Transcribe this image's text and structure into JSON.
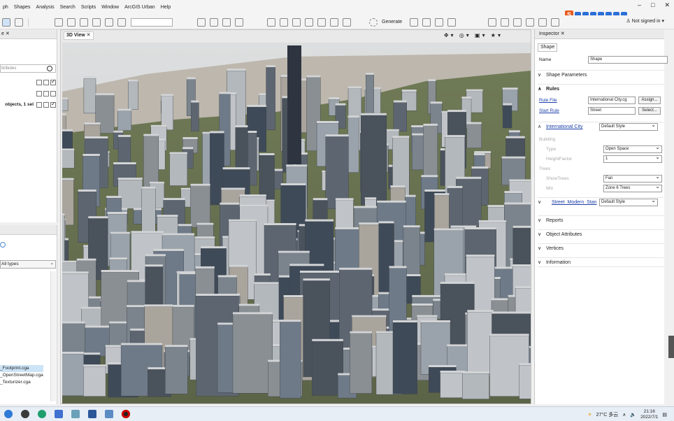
{
  "menubar": {
    "items": [
      "ph",
      "Shapes",
      "Analysis",
      "Search",
      "Scripts",
      "Window",
      "ArcGIS Urban",
      "Help"
    ],
    "window_controls": [
      "–",
      "□",
      "✕"
    ]
  },
  "toolbar": {
    "generate_label": "Generate",
    "signed_in_label": "Not signed in",
    "signed_in_arrow": "▾"
  },
  "left_top": {
    "tab_label": "e ✕",
    "search_placeholder": "ttributes",
    "objects_label": "objects, 1 sel"
  },
  "left_bottom": {
    "type_select": "All types",
    "files": [
      "_Footprint.cga",
      "_OpenStreetMap.cga",
      "_Texturizer.cga"
    ]
  },
  "view": {
    "tab_label": "3D View ✕"
  },
  "inspector": {
    "tab_label": "Inspector ✕",
    "shape_tab": "Shape",
    "name_label": "Name",
    "name_value": "Shape",
    "shape_parameters": "Shape Parameters",
    "rules": "Rules",
    "rule_file_label": "Rule File",
    "rule_file_value": "International City.cg",
    "assign_button": "Assign...",
    "start_rule_label": "Start Rule",
    "start_rule_value": "Street",
    "select_button": "Select...",
    "international_city_label": "International City",
    "international_city_value": "Default Style",
    "building_group": "Building",
    "type_label": "Type",
    "type_value": "Open Space",
    "height_factor_label": "HeightFactor",
    "height_factor_value": "1",
    "trees_group": "Trees",
    "show_trees_label": "ShowTrees",
    "show_trees_value": "Fan",
    "mix_label": "Mix",
    "mix_value": "Zone 6 Trees",
    "street_label": "Street_Modern_Stan",
    "street_value": "Default Style",
    "reports": "Reports",
    "object_attributes": "Object Attributes",
    "vertices": "Vertices",
    "information": "Information"
  },
  "taskbar": {
    "weather": "27°C 多云",
    "time": "21:16",
    "date": "2022/7/1"
  },
  "colors": {
    "sky": "#d7d9dc",
    "water": "#bdb7ad",
    "ground": "#6d7a52",
    "accent": "#1a3ea8"
  }
}
